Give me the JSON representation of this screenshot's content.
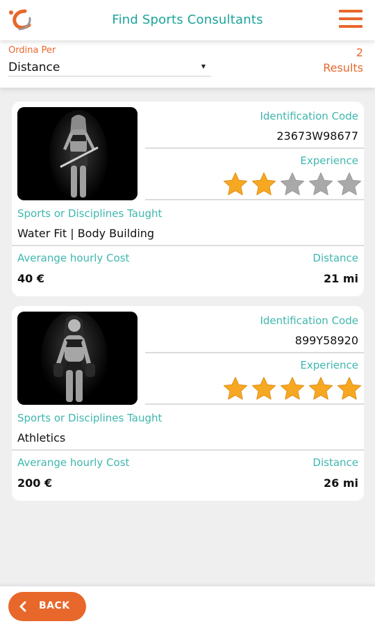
{
  "header": {
    "title": "Find Sports Consultants",
    "logo_icon": "brand-swoosh-logo",
    "menu_icon": "hamburger-menu-icon"
  },
  "filter": {
    "sort_label": "Ordina Per",
    "sort_value": "Distance",
    "results_count": "2",
    "results_label": "Results"
  },
  "labels": {
    "id_label": "Identification Code",
    "experience_label": "Experience",
    "sports_label": "Sports or Disciplines Taught",
    "cost_label": "Averange hourly Cost",
    "distance_label": "Distance"
  },
  "consultants": [
    {
      "id_code": "23673W98677",
      "experience_rating": 2,
      "experience_max": 5,
      "sports": "Water Fit | Body Building",
      "hourly_cost": "40 €",
      "distance": "21 mi"
    },
    {
      "id_code": "899Y58920",
      "experience_rating": 5,
      "experience_max": 5,
      "sports": "Athletics",
      "hourly_cost": "200 €",
      "distance": "26 mi"
    }
  ],
  "footer": {
    "back_label": "BACK",
    "back_icon": "chevron-left-icon"
  },
  "colors": {
    "accent_orange": "#e8672a",
    "teal": "#1aa39a",
    "label_teal": "#3fb7ad",
    "star_filled": "#f7a823",
    "star_empty": "#a9a9a9"
  }
}
